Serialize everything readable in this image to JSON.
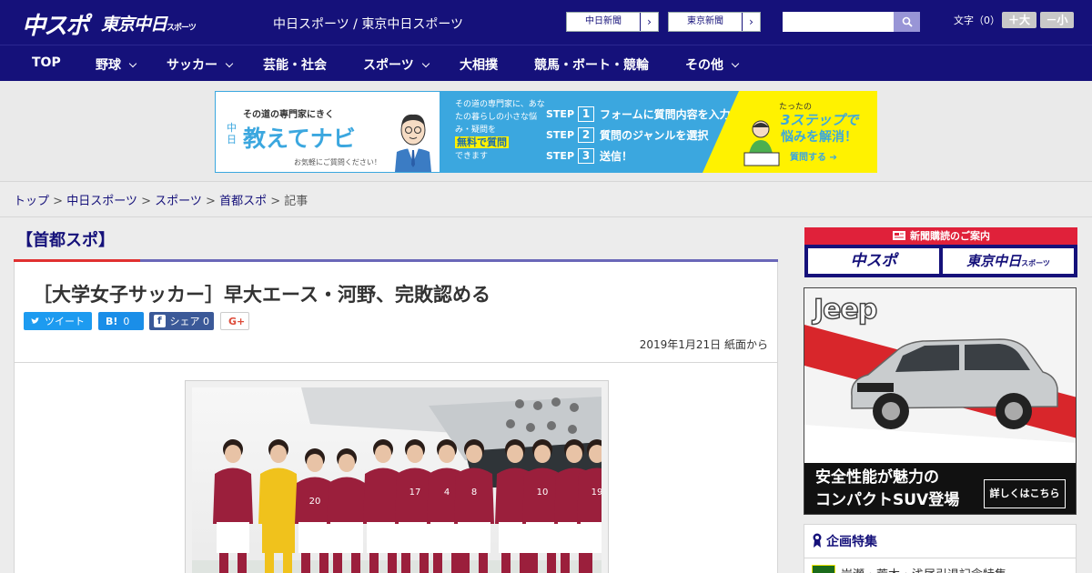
{
  "header": {
    "logo_main": "中スポ",
    "logo_sub": "東京中日",
    "logo_sub_small": "スポーツ",
    "site_links": "中日スポーツ / 東京中日スポーツ",
    "paper_buttons": [
      {
        "label": "中日新聞",
        "arrow": "›"
      },
      {
        "label": "東京新聞",
        "arrow": "›"
      }
    ],
    "search_placeholder": "",
    "font_size_label": "文字（0）",
    "font_larger": "＋大",
    "font_smaller": "－小"
  },
  "nav": [
    {
      "label": "TOP",
      "has_menu": false
    },
    {
      "label": "野球",
      "has_menu": true
    },
    {
      "label": "サッカー",
      "has_menu": true
    },
    {
      "label": "芸能・社会",
      "has_menu": false
    },
    {
      "label": "スポーツ",
      "has_menu": true
    },
    {
      "label": "大相撲",
      "has_menu": false
    },
    {
      "label": "競馬・ボート・競輪",
      "has_menu": false
    },
    {
      "label": "その他",
      "has_menu": true
    }
  ],
  "ad_banner": {
    "tagline": "その道の専門家にきく",
    "brand_prefix": "中日",
    "title": "教えてナビ",
    "note": "お気軽にご質問ください！",
    "middle_text": "その道の専門家に、あなたの暮らしの小さな悩み・疑問を",
    "middle_highlight": "無料で質問",
    "middle_tail": "できます",
    "steps": [
      {
        "tag": "STEP",
        "num": "1",
        "text": "フォームに質問内容を入力"
      },
      {
        "tag": "STEP",
        "num": "2",
        "text": "質問のジャンルを選択"
      },
      {
        "tag": "STEP",
        "num": "3",
        "text": "送信！"
      }
    ],
    "right_small": "たったの",
    "right_big": "3ステップで",
    "right_mid": "悩みを解消！",
    "right_cta": "質問する ➔"
  },
  "breadcrumb": {
    "items": [
      "トップ",
      "中日スポーツ",
      "スポーツ",
      "首都スポ"
    ],
    "current": "記事",
    "separator": ">"
  },
  "section_label": "【首都スポ】",
  "article": {
    "headline": "［大学女子サッカー］早大エース・河野、完敗認める",
    "share": [
      {
        "icon": "t",
        "label": "ツイート",
        "count": "",
        "color": "#1d9bf0"
      },
      {
        "icon": "B!",
        "label": "",
        "count": "0",
        "color": "#1a8ee8"
      },
      {
        "icon": "f",
        "label": "シェア",
        "count": "0",
        "color": "#3b5998"
      },
      {
        "icon": "G+",
        "label": "",
        "count": "",
        "color": "#ffffff"
      }
    ],
    "dateline": "2019年1月21日 紙面から",
    "player_numbers": [
      "",
      "",
      "20",
      "",
      "",
      "17",
      "4",
      "8",
      "",
      "10",
      "",
      "19"
    ]
  },
  "sidebar": {
    "subscription_head": "新聞購読のご案内",
    "subscription_buttons": [
      "中スポ",
      "東京中日"
    ],
    "subscription_small": "スポーツ",
    "jeep_logo": "Jeep",
    "jeep_copy_line1": "安全性能が魅力の",
    "jeep_copy_line2": "コンパクトSUV登場",
    "jeep_button": "詳しくはこちら",
    "feature_head": "企画特集",
    "feature_item": "岩瀬・荒木・浅尾引退記念特集"
  },
  "colors": {
    "brand_navy": "#15117a",
    "accent_red": "#e03030",
    "banner_blue": "#3ba7df",
    "banner_yellow": "#fff200"
  }
}
